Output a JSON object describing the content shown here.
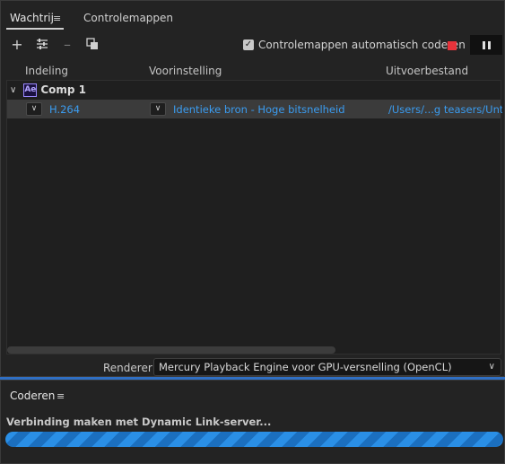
{
  "tabs": [
    {
      "label": "Wachtrij",
      "active": true
    },
    {
      "label": "Controlemappen",
      "active": false
    }
  ],
  "toolbar": {
    "add_icon": "plus-icon",
    "settings_icon": "sliders-icon",
    "remove_icon": "minus-icon",
    "duplicate_icon": "duplicate-icon",
    "auto_encode_label": "Controlemappen automatisch coderen",
    "auto_encode_checked": true,
    "stop_color": "#e7333b"
  },
  "queue": {
    "columns": [
      "Indeling",
      "Voorinstelling",
      "Uitvoerbestand"
    ],
    "group": {
      "badge": "Ae",
      "name": "Comp 1"
    },
    "item": {
      "format": "H.264",
      "preset": "Identieke bron - Hoge bitsnelheid",
      "output": "/Users/...g teasers/Untitled"
    }
  },
  "renderer": {
    "label": "Renderer:",
    "value": "Mercury Playback Engine voor GPU-versnelling (OpenCL)"
  },
  "encoding": {
    "tab_label": "Coderen",
    "status": "Verbinding maken met Dynamic Link-server...",
    "progress": 1.0
  },
  "colors": {
    "accent": "#3b9cf0",
    "progress": "#2a8fe6"
  }
}
